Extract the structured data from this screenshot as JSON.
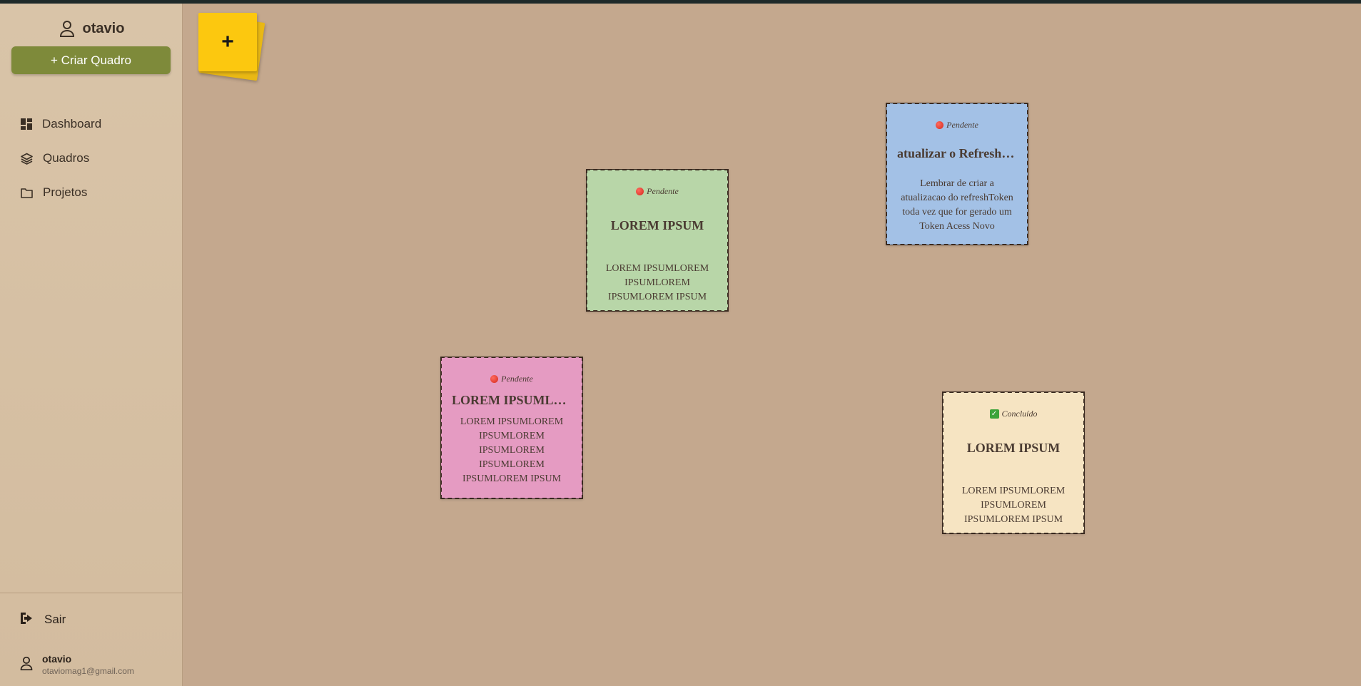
{
  "sidebar": {
    "user_name": "otavio",
    "create_button": "+ Criar Quadro",
    "nav": [
      {
        "label": "Dashboard",
        "icon": "dashboard-icon"
      },
      {
        "label": "Quadros",
        "icon": "layers-icon"
      },
      {
        "label": "Projetos",
        "icon": "folder-icon"
      }
    ],
    "logout": "Sair",
    "footer": {
      "name": "otavio",
      "email": "otaviomag1@gmail.com"
    }
  },
  "board": {
    "add_note_label": "+",
    "notes": [
      {
        "color": "#b8d6a8",
        "status": "Pendente",
        "status_icon": "red-dot-icon",
        "title": "LOREM IPSUM",
        "description": "LOREM IPSUMLOREM IPSUMLOREM IPSUMLOREM IPSUM"
      },
      {
        "color": "#a3c1e6",
        "status": "Pendente",
        "status_icon": "red-dot-icon",
        "title": "atualizar o RefreshToken",
        "description": "Lembrar de criar a atualizacao do refreshToken toda vez que for gerado um Token Acess Novo"
      },
      {
        "color": "#e59bc2",
        "status": "Pendente",
        "status_icon": "red-dot-icon",
        "title": "LOREM IPSUMLOREM IPSUM",
        "description": "LOREM IPSUMLOREM IPSUMLOREM IPSUMLOREM IPSUMLOREM IPSUMLOREM IPSUM"
      },
      {
        "color": "#f6e4c2",
        "status": "Concluído",
        "status_icon": "check-icon",
        "title": "LOREM IPSUM",
        "description": "LOREM IPSUMLOREM IPSUMLOREM IPSUMLOREM IPSUM"
      }
    ]
  }
}
